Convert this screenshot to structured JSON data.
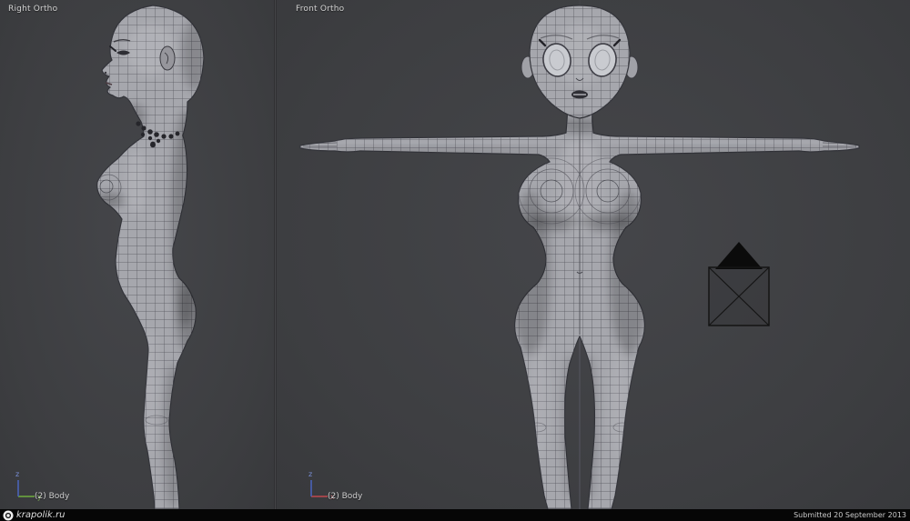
{
  "viewports": {
    "left": {
      "view_label": "Right Ortho",
      "object_label": "(2) Body",
      "axis_horizontal": "y",
      "axis_vertical": "z"
    },
    "right": {
      "view_label": "Front Ortho",
      "object_label": "(2) Body",
      "axis_horizontal": "x",
      "axis_vertical": "z"
    }
  },
  "footer": {
    "watermark_text": "krapolik.ru",
    "submitted_text": "Submitted 20 September 2013"
  },
  "colors": {
    "viewport_background": "#3f4043",
    "model_surface": "#a6a7ad",
    "wireframe_line": "#53545c",
    "model_outline": "#33343a",
    "axis_x": "#c1494f",
    "axis_y": "#6fae3f",
    "axis_z": "#4a62b8",
    "label_text": "#d4d4d4",
    "footer_background": "#060606"
  }
}
